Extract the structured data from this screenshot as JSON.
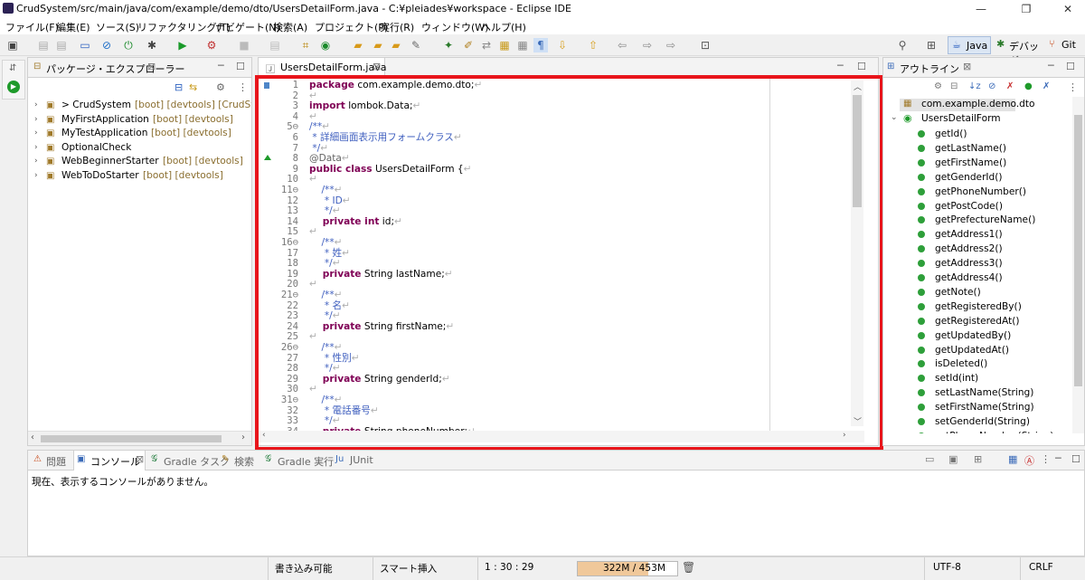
{
  "window": {
    "title": "CrudSystem/src/main/java/com/example/demo/dto/UsersDetailForm.java - C:¥pleiades¥workspace - Eclipse IDE",
    "controls": [
      "—",
      "❐",
      "✕"
    ]
  },
  "menu": [
    "ファイル(F)",
    "編集(E)",
    "ソース(S)",
    "リファクタリング(T)",
    "ナビゲート(N)",
    "検索(A)",
    "プロジェクト(P)",
    "実行(R)",
    "ウィンドウ(W)",
    "ヘルプ(H)"
  ],
  "perspectives": {
    "java": "Java",
    "debug": "デバッグ",
    "git": "Git"
  },
  "package_explorer": {
    "tab": "パッケージ・エクスプローラー",
    "items": [
      {
        "name": "> CrudSystem",
        "tag": "[boot] [devtools] [CrudSystem m"
      },
      {
        "name": "MyFirstApplication",
        "tag": "[boot] [devtools]"
      },
      {
        "name": "MyTestApplication",
        "tag": "[boot] [devtools]"
      },
      {
        "name": "OptionalCheck",
        "tag": ""
      },
      {
        "name": "WebBeginnerStarter",
        "tag": "[boot] [devtools]"
      },
      {
        "name": "WebToDoStarter",
        "tag": "[boot] [devtools]"
      }
    ]
  },
  "editor": {
    "tab": "UsersDetailForm.java",
    "lines": [
      {
        "n": "1",
        "parts": [
          {
            "c": "kw",
            "t": "package"
          },
          {
            "c": "",
            "t": " com.example.demo.dto;"
          }
        ]
      },
      {
        "n": "2",
        "parts": []
      },
      {
        "n": "3",
        "parts": [
          {
            "c": "kw",
            "t": "import"
          },
          {
            "c": "",
            "t": " lombok.Data;"
          }
        ]
      },
      {
        "n": "4",
        "parts": []
      },
      {
        "n": "5⊖",
        "parts": [
          {
            "c": "cm",
            "t": "/**"
          }
        ]
      },
      {
        "n": "6",
        "parts": [
          {
            "c": "cm",
            "t": " * 詳細画面表示用フォームクラス"
          }
        ]
      },
      {
        "n": "7",
        "parts": [
          {
            "c": "cm",
            "t": " */"
          }
        ]
      },
      {
        "n": "8",
        "parts": [
          {
            "c": "an",
            "t": "@Data"
          }
        ]
      },
      {
        "n": "9",
        "parts": [
          {
            "c": "kw",
            "t": "public class"
          },
          {
            "c": "",
            "t": " UsersDetailForm {"
          }
        ]
      },
      {
        "n": "10",
        "parts": []
      },
      {
        "n": "11⊖",
        "parts": [
          {
            "c": "cm",
            "t": "    /**"
          }
        ]
      },
      {
        "n": "12",
        "parts": [
          {
            "c": "cm",
            "t": "     * ID"
          }
        ]
      },
      {
        "n": "13",
        "parts": [
          {
            "c": "cm",
            "t": "     */"
          }
        ]
      },
      {
        "n": "14",
        "parts": [
          {
            "c": "kw",
            "t": "    private int"
          },
          {
            "c": "",
            "t": " id;"
          }
        ]
      },
      {
        "n": "15",
        "parts": []
      },
      {
        "n": "16⊖",
        "parts": [
          {
            "c": "cm",
            "t": "    /**"
          }
        ]
      },
      {
        "n": "17",
        "parts": [
          {
            "c": "cm",
            "t": "     * 姓"
          }
        ]
      },
      {
        "n": "18",
        "parts": [
          {
            "c": "cm",
            "t": "     */"
          }
        ]
      },
      {
        "n": "19",
        "parts": [
          {
            "c": "kw",
            "t": "    private"
          },
          {
            "c": "",
            "t": " String lastName;"
          }
        ]
      },
      {
        "n": "20",
        "parts": []
      },
      {
        "n": "21⊖",
        "parts": [
          {
            "c": "cm",
            "t": "    /**"
          }
        ]
      },
      {
        "n": "22",
        "parts": [
          {
            "c": "cm",
            "t": "     * 名"
          }
        ]
      },
      {
        "n": "23",
        "parts": [
          {
            "c": "cm",
            "t": "     */"
          }
        ]
      },
      {
        "n": "24",
        "parts": [
          {
            "c": "kw",
            "t": "    private"
          },
          {
            "c": "",
            "t": " String firstName;"
          }
        ]
      },
      {
        "n": "25",
        "parts": []
      },
      {
        "n": "26⊖",
        "parts": [
          {
            "c": "cm",
            "t": "    /**"
          }
        ]
      },
      {
        "n": "27",
        "parts": [
          {
            "c": "cm",
            "t": "     * 性別"
          }
        ]
      },
      {
        "n": "28",
        "parts": [
          {
            "c": "cm",
            "t": "     */"
          }
        ]
      },
      {
        "n": "29",
        "parts": [
          {
            "c": "kw",
            "t": "    private"
          },
          {
            "c": "",
            "t": " String genderId;"
          }
        ]
      },
      {
        "n": "30",
        "parts": []
      },
      {
        "n": "31⊖",
        "parts": [
          {
            "c": "cm",
            "t": "    /**"
          }
        ]
      },
      {
        "n": "32",
        "parts": [
          {
            "c": "cm",
            "t": "     * 電話番号"
          }
        ]
      },
      {
        "n": "33",
        "parts": [
          {
            "c": "cm",
            "t": "     */"
          }
        ]
      },
      {
        "n": "34",
        "parts": [
          {
            "c": "kw",
            "t": "    private"
          },
          {
            "c": "",
            "t": " String phoneNumber;"
          }
        ]
      }
    ]
  },
  "outline": {
    "tab": "アウトライン",
    "package": "com.example.demo.dto",
    "class": "UsersDetailForm",
    "members": [
      "getId()",
      "getLastName()",
      "getFirstName()",
      "getGenderId()",
      "getPhoneNumber()",
      "getPostCode()",
      "getPrefectureName()",
      "getAddress1()",
      "getAddress2()",
      "getAddress3()",
      "getAddress4()",
      "getNote()",
      "getRegisteredBy()",
      "getRegisteredAt()",
      "getUpdatedBy()",
      "getUpdatedAt()",
      "isDeleted()",
      "setId(int)",
      "setLastName(String)",
      "setFirstName(String)",
      "setGenderId(String)",
      "setPhoneNumber(String)"
    ]
  },
  "bottom": {
    "tabs": [
      "問題",
      "コンソール",
      "Gradle タスク",
      "検索",
      "Gradle 実行",
      "JUnit"
    ],
    "console_message": "現在、表示するコンソールがありません。"
  },
  "status": {
    "writable": "書き込み可能",
    "insert_mode": "スマート挿入",
    "position": "1 : 30 : 29",
    "memory": "322M / 453M",
    "memory_used_fraction": 0.71,
    "encoding": "UTF-8",
    "line_ending": "CRLF"
  },
  "colors": {
    "highlight_border": "#e8151b",
    "keyword": "#7f0055",
    "comment": "#3f5fbf"
  }
}
